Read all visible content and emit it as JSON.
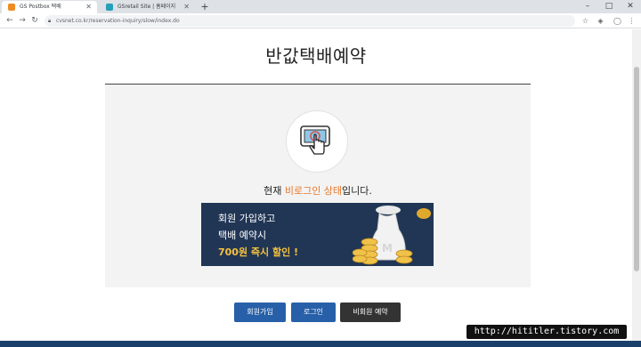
{
  "browser": {
    "tabs": [
      {
        "label": "GS Postbox 택배",
        "favicon_color": "#f08a24"
      },
      {
        "label": "GSretail Site | 홈페이지",
        "favicon_color": "#26a0b8"
      }
    ],
    "new_tab_symbol": "+",
    "url": "cvsnet.co.kr/reservation-inquiry/slow/index.do"
  },
  "page": {
    "title": "반값택배예약",
    "status_prefix": "현재 ",
    "status_highlight": "비로그인 상태",
    "status_suffix": "입니다.",
    "banner": {
      "line1": "회원 가입하고",
      "line2": "택배 예약시",
      "line3": "700원 즉시 할인 !"
    },
    "buttons": {
      "join": "회원가입",
      "login": "로그인",
      "guest": "비회원 예약"
    }
  },
  "watermark": "http://hititler.tistory.com",
  "colors": {
    "accent_blue": "#2760a8",
    "highlight_orange": "#e8792b",
    "banner_navy": "#213655",
    "banner_gold": "#f6c23e"
  }
}
